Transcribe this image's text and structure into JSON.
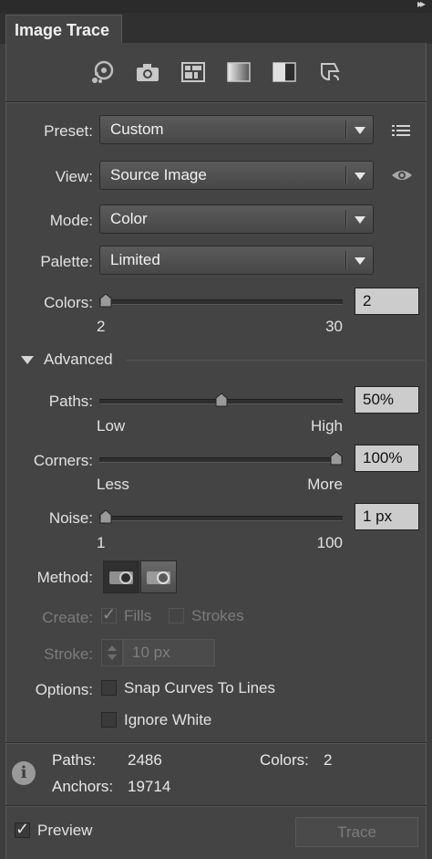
{
  "window": {
    "collapse_glyph": "▸▸"
  },
  "tab": {
    "title": "Image Trace"
  },
  "toolbar": {
    "icons": [
      "auto-color-icon",
      "high-color-icon",
      "low-color-icon",
      "grayscale-icon",
      "black-and-white-icon",
      "outline-icon"
    ]
  },
  "preset": {
    "label": "Preset:",
    "value": "Custom"
  },
  "view": {
    "label": "View:",
    "value": "Source Image"
  },
  "mode": {
    "label": "Mode:",
    "value": "Color"
  },
  "palette": {
    "label": "Palette:",
    "value": "Limited"
  },
  "colors": {
    "label": "Colors:",
    "value": "2",
    "min_label": "2",
    "max_label": "30",
    "level": 0
  },
  "advanced": {
    "label": "Advanced"
  },
  "paths": {
    "label": "Paths:",
    "value": "50%",
    "min_label": "Low",
    "max_label": "High",
    "level": 0.5
  },
  "corners": {
    "label": "Corners:",
    "value": "100%",
    "min_label": "Less",
    "max_label": "More",
    "level": 1.0
  },
  "noise": {
    "label": "Noise:",
    "value": "1 px",
    "min_label": "1",
    "max_label": "100",
    "level": 0
  },
  "method": {
    "label": "Method:"
  },
  "create": {
    "label": "Create:",
    "fills": "Fills",
    "strokes": "Strokes",
    "fills_checked": true,
    "strokes_checked": false
  },
  "stroke": {
    "label": "Stroke:",
    "value": "10 px"
  },
  "options": {
    "label": "Options:",
    "snap": "Snap Curves To Lines",
    "ignore_white": "Ignore White"
  },
  "stats": {
    "paths_label": "Paths:",
    "paths_value": "2486",
    "colors_label": "Colors:",
    "colors_value": "2",
    "anchors_label": "Anchors:",
    "anchors_value": "19714"
  },
  "footer": {
    "preview": "Preview",
    "preview_checked": true,
    "trace": "Trace"
  },
  "colors_theme": {
    "panel": "#444444",
    "field": "#cccccc"
  }
}
